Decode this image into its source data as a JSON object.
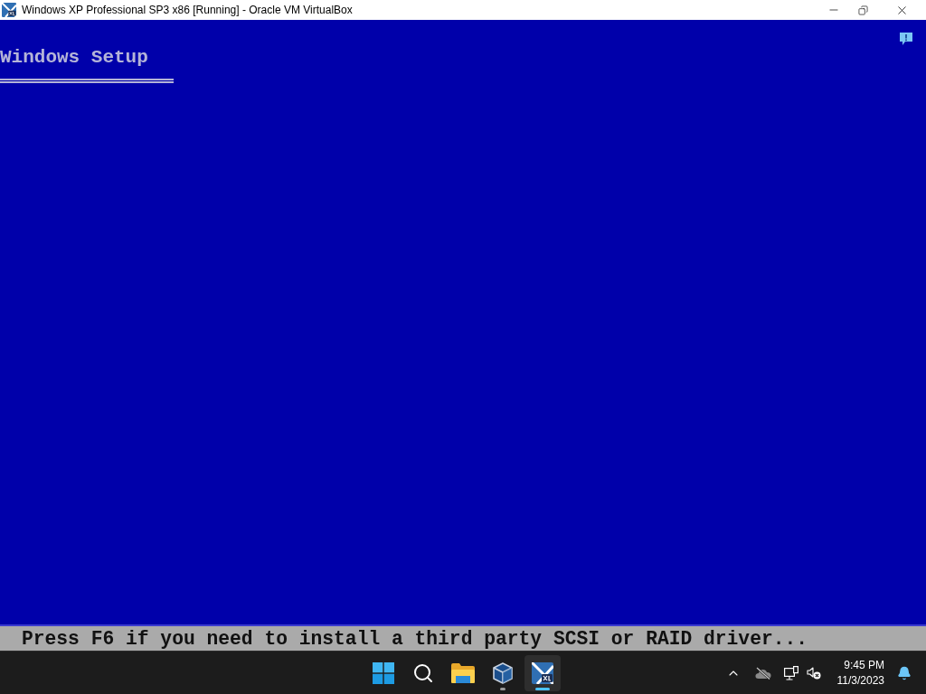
{
  "window": {
    "title": "Windows XP Professional SP3 x86 [Running] - Oracle VM VirtualBox"
  },
  "vm_screen": {
    "heading": "Windows Setup",
    "status_line": "Press F6 if you need to install a third party SCSI or RAID driver..."
  },
  "taskbar": {
    "apps": [
      {
        "kind": "start",
        "running": false,
        "selected": false
      },
      {
        "kind": "search",
        "running": false,
        "selected": false
      },
      {
        "kind": "files",
        "running": false,
        "selected": false
      },
      {
        "kind": "virtualbox",
        "running": true,
        "selected": false
      },
      {
        "kind": "vm",
        "running": true,
        "selected": true
      }
    ],
    "clock": {
      "time": "9:45 PM",
      "date": "11/3/2023"
    }
  }
}
